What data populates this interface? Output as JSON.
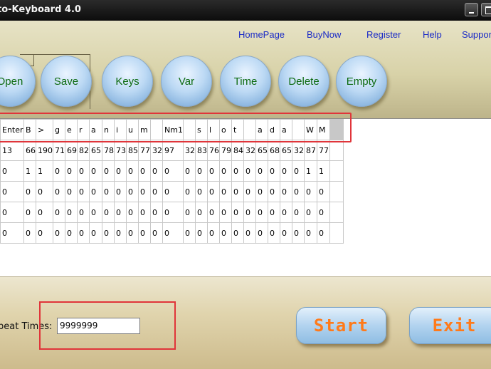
{
  "window": {
    "title": "to-Keyboard 4.0"
  },
  "nav": [
    "HomePage",
    "BuyNow",
    "Register",
    "Help",
    "Support"
  ],
  "toolbar": [
    "Open",
    "Save",
    "Keys",
    "Var",
    "Time",
    "Delete",
    "Empty"
  ],
  "grid": {
    "headers": [
      "Enter",
      "B",
      ">",
      "g",
      "e",
      "r",
      "a",
      "n",
      "i",
      "u",
      "m",
      "",
      "Nm1",
      "",
      "s",
      "l",
      "o",
      "t",
      "",
      "a",
      "d",
      "a",
      "",
      "W",
      "M"
    ],
    "rows": [
      [
        "13",
        "66",
        "190",
        "71",
        "69",
        "82",
        "65",
        "78",
        "73",
        "85",
        "77",
        "32",
        "97",
        "32",
        "83",
        "76",
        "79",
        "84",
        "32",
        "65",
        "68",
        "65",
        "32",
        "87",
        "77"
      ],
      [
        "0",
        "1",
        "1",
        "0",
        "0",
        "0",
        "0",
        "0",
        "0",
        "0",
        "0",
        "0",
        "0",
        "0",
        "0",
        "0",
        "0",
        "0",
        "0",
        "0",
        "0",
        "0",
        "0",
        "1",
        "1"
      ],
      [
        "0",
        "0",
        "0",
        "0",
        "0",
        "0",
        "0",
        "0",
        "0",
        "0",
        "0",
        "0",
        "0",
        "0",
        "0",
        "0",
        "0",
        "0",
        "0",
        "0",
        "0",
        "0",
        "0",
        "0",
        "0"
      ],
      [
        "0",
        "0",
        "0",
        "0",
        "0",
        "0",
        "0",
        "0",
        "0",
        "0",
        "0",
        "0",
        "0",
        "0",
        "0",
        "0",
        "0",
        "0",
        "0",
        "0",
        "0",
        "0",
        "0",
        "0",
        "0"
      ],
      [
        "0",
        "0",
        "0",
        "0",
        "0",
        "0",
        "0",
        "0",
        "0",
        "0",
        "0",
        "0",
        "0",
        "0",
        "0",
        "0",
        "0",
        "0",
        "0",
        "0",
        "0",
        "0",
        "0",
        "0",
        "0"
      ]
    ]
  },
  "footer": {
    "repeat_label": "peat Times:",
    "repeat_value": "9999999",
    "start_label": "Start",
    "exit_label": "Exit"
  },
  "colors": {
    "highlight": "#e0353a",
    "link": "#1a2ac6",
    "button_text": "#0c6a10",
    "big_button_text": "#ff7a1a"
  }
}
